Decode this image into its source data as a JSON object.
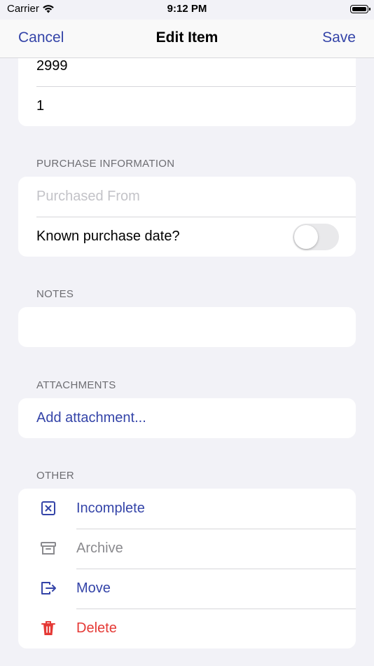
{
  "status_bar": {
    "carrier": "Carrier",
    "time": "9:12 PM"
  },
  "nav": {
    "cancel_label": "Cancel",
    "title": "Edit Item",
    "save_label": "Save"
  },
  "top_group": {
    "price_value": "2999",
    "quantity_value": "1"
  },
  "purchase": {
    "header": "PURCHASE INFORMATION",
    "purchased_from_placeholder": "Purchased From",
    "known_date_label": "Known purchase date?",
    "known_date_on": false
  },
  "notes": {
    "header": "NOTES"
  },
  "attachments": {
    "header": "ATTACHMENTS",
    "add_label": "Add attachment..."
  },
  "other": {
    "header": "OTHER",
    "actions": [
      {
        "label": "Incomplete",
        "icon": "x-square-icon"
      },
      {
        "label": "Archive",
        "icon": "archive-box-icon"
      },
      {
        "label": "Move",
        "icon": "move-out-icon"
      },
      {
        "label": "Delete",
        "icon": "trash-icon"
      }
    ]
  },
  "colors": {
    "accent": "#3444a8",
    "danger": "#e53935",
    "muted": "#8a8a8e",
    "background": "#f2f2f7"
  }
}
